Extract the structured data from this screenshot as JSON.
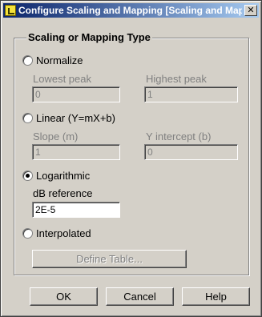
{
  "window": {
    "title": "Configure Scaling and Mapping [Scaling and Map...",
    "icon": "app-icon",
    "close_glyph": "✕"
  },
  "group": {
    "legend": "Scaling or Mapping Type"
  },
  "normalize": {
    "label": "Normalize",
    "selected": false,
    "lowest_label": "Lowest peak",
    "lowest_value": "0",
    "highest_label": "Highest peak",
    "highest_value": "1"
  },
  "linear": {
    "label": "Linear (Y=mX+b)",
    "selected": false,
    "slope_label": "Slope (m)",
    "slope_value": "1",
    "intercept_label": "Y intercept (b)",
    "intercept_value": "0"
  },
  "logarithmic": {
    "label": "Logarithmic",
    "selected": true,
    "db_label": "dB reference",
    "db_value": "2E-5"
  },
  "interpolated": {
    "label": "Interpolated",
    "selected": false,
    "define_table_label": "Define Table..."
  },
  "buttons": {
    "ok": "OK",
    "cancel": "Cancel",
    "help": "Help"
  }
}
